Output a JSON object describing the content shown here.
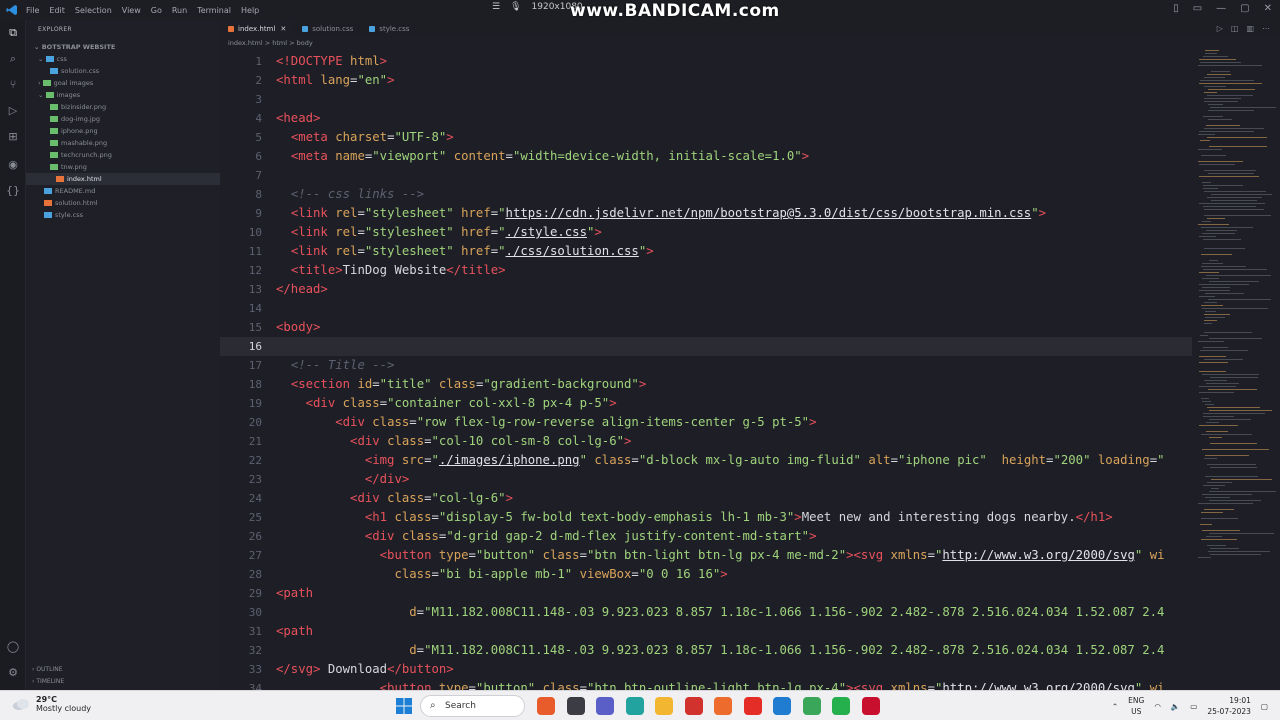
{
  "titlebar": {
    "menu": [
      "File",
      "Edit",
      "Selection",
      "View",
      "Go",
      "Run",
      "Terminal",
      "Help"
    ],
    "watermark": "www.BANDICAM.com",
    "resolution": "1920x1080"
  },
  "sidebar": {
    "header": "EXPLORER",
    "project": "BOTSTRAP WEBSITE",
    "items": [
      {
        "label": "css",
        "color": "#4aa3df"
      },
      {
        "label": "solution.css",
        "color": "#4aa3df"
      },
      {
        "label": "goal images",
        "color": "#6bbd6e"
      },
      {
        "label": "images",
        "color": "#6bbd6e"
      },
      {
        "label": "bizinsider.png",
        "color": "#6bbd6e"
      },
      {
        "label": "dog-img.jpg",
        "color": "#6bbd6e"
      },
      {
        "label": "iphone.png",
        "color": "#6bbd6e"
      },
      {
        "label": "mashable.png",
        "color": "#6bbd6e"
      },
      {
        "label": "techcrunch.png",
        "color": "#6bbd6e"
      },
      {
        "label": "tnw.png",
        "color": "#6bbd6e"
      },
      {
        "label": "index.html",
        "color": "#e8733a"
      },
      {
        "label": "README.md",
        "color": "#4aa3df"
      },
      {
        "label": "solution.html",
        "color": "#e8733a"
      },
      {
        "label": "style.css",
        "color": "#4aa3df"
      }
    ],
    "outline": "OUTLINE",
    "timeline": "TIMELINE"
  },
  "tabs": [
    {
      "label": "index.html",
      "active": true,
      "color": "#e8733a"
    },
    {
      "label": "solution.css",
      "active": false,
      "color": "#4aa3df"
    },
    {
      "label": "style.css",
      "active": false,
      "color": "#4aa3df"
    }
  ],
  "breadcrumb": "index.html > html > body",
  "code": {
    "current_line": 16,
    "lines": [
      {
        "n": "1",
        "html": "<span class='tg'>&lt;!DOCTYPE </span><span class='at'>html</span><span class='tg'>&gt;</span>"
      },
      {
        "n": "2",
        "html": "<span class='tg'>&lt;html </span><span class='at'>lang</span><span class='pl'>=</span><span class='st'>\"en\"</span><span class='tg'>&gt;</span>"
      },
      {
        "n": "3",
        "html": ""
      },
      {
        "n": "4",
        "html": "<span class='tg'>&lt;head&gt;</span>"
      },
      {
        "n": "5",
        "html": "  <span class='tg'>&lt;meta </span><span class='at'>charset</span><span class='pl'>=</span><span class='st'>\"UTF-8\"</span><span class='tg'>&gt;</span>"
      },
      {
        "n": "6",
        "html": "  <span class='tg'>&lt;meta </span><span class='at'>name</span><span class='pl'>=</span><span class='st'>\"viewport\"</span> <span class='at'>content</span><span class='pl'>=</span><span class='st'>\"width=device-width, initial-scale=1.0\"</span><span class='tg'>&gt;</span>"
      },
      {
        "n": "7",
        "html": ""
      },
      {
        "n": "8",
        "html": "  <span class='cm'>&lt;!-- css links --&gt;</span>"
      },
      {
        "n": "9",
        "html": "  <span class='tg'>&lt;link </span><span class='at'>rel</span><span class='pl'>=</span><span class='st'>\"stylesheet\"</span> <span class='at'>href</span><span class='pl'>=</span><span class='st'>\"<span class='ul'>https://cdn.jsdelivr.net/npm/bootstrap@5.3.0/dist/css/bootstrap.min.css</span>\"</span><span class='tg'>&gt;</span>"
      },
      {
        "n": "10",
        "html": "  <span class='tg'>&lt;link </span><span class='at'>rel</span><span class='pl'>=</span><span class='st'>\"stylesheet\"</span> <span class='at'>href</span><span class='pl'>=</span><span class='st'>\"<span class='ul'>./style.css</span>\"</span><span class='tg'>&gt;</span>"
      },
      {
        "n": "11",
        "html": "  <span class='tg'>&lt;link </span><span class='at'>rel</span><span class='pl'>=</span><span class='st'>\"stylesheet\"</span> <span class='at'>href</span><span class='pl'>=</span><span class='st'>\"<span class='ul'>./css/solution.css</span>\"</span><span class='tg'>&gt;</span>"
      },
      {
        "n": "12",
        "html": "  <span class='tg'>&lt;title&gt;</span><span class='pl'>TinDog Website</span><span class='tg'>&lt;/title&gt;</span>"
      },
      {
        "n": "13",
        "html": "<span class='tg'>&lt;/head&gt;</span>"
      },
      {
        "n": "14",
        "html": ""
      },
      {
        "n": "15",
        "html": "<span class='tg'>&lt;body&gt;</span>"
      },
      {
        "n": "16",
        "html": ""
      },
      {
        "n": "17",
        "html": "  <span class='cm'>&lt;!-- Title --&gt;</span>"
      },
      {
        "n": "18",
        "html": "  <span class='tg'>&lt;section </span><span class='at'>id</span><span class='pl'>=</span><span class='st'>\"title\"</span> <span class='at'>class</span><span class='pl'>=</span><span class='st'>\"gradient-background\"</span><span class='tg'>&gt;</span>"
      },
      {
        "n": "19",
        "html": "    <span class='tg'>&lt;div </span><span class='at'>class</span><span class='pl'>=</span><span class='st'>\"container col-xxl-8 px-4 p-5\"</span><span class='tg'>&gt;</span>"
      },
      {
        "n": "20",
        "html": "        <span class='tg'>&lt;div </span><span class='at'>class</span><span class='pl'>=</span><span class='st'>\"row flex-lg-row-reverse align-items-center g-5 pt-5\"</span><span class='tg'>&gt;</span>"
      },
      {
        "n": "21",
        "html": "          <span class='tg'>&lt;div </span><span class='at'>class</span><span class='pl'>=</span><span class='st'>\"col-10 col-sm-8 col-lg-6\"</span><span class='tg'>&gt;</span>"
      },
      {
        "n": "22",
        "html": "            <span class='tg'>&lt;img </span><span class='at'>src</span><span class='pl'>=</span><span class='st'>\"<span class='ul'>./images/iphone.png</span>\"</span> <span class='at'>class</span><span class='pl'>=</span><span class='st'>\"d-block mx-lg-auto img-fluid\"</span> <span class='at'>alt</span><span class='pl'>=</span><span class='st'>\"iphone pic\"</span>  <span class='at'>height</span><span class='pl'>=</span><span class='st'>\"200\"</span> <span class='at'>loading</span><span class='pl'>=</span><span class='st'>\"</span>"
      },
      {
        "n": "23",
        "html": "            <span class='tg'>&lt;/div&gt;</span>"
      },
      {
        "n": "24",
        "html": "          <span class='tg'>&lt;div </span><span class='at'>class</span><span class='pl'>=</span><span class='st'>\"col-lg-6\"</span><span class='tg'>&gt;</span>"
      },
      {
        "n": "25",
        "html": "            <span class='tg'>&lt;h1 </span><span class='at'>class</span><span class='pl'>=</span><span class='st'>\"display-5 fw-bold text-body-emphasis lh-1 mb-3\"</span><span class='tg'>&gt;</span><span class='pl'>Meet new and interesting dogs nearby.</span><span class='tg'>&lt;/h1&gt;</span>"
      },
      {
        "n": "26",
        "html": "            <span class='tg'>&lt;div </span><span class='at'>class</span><span class='pl'>=</span><span class='st'>\"d-grid gap-2 d-md-flex justify-content-md-start\"</span><span class='tg'>&gt;</span>"
      },
      {
        "n": "27",
        "html": "              <span class='tg'>&lt;button </span><span class='at'>type</span><span class='pl'>=</span><span class='st'>\"button\"</span> <span class='at'>class</span><span class='pl'>=</span><span class='st'>\"btn btn-light btn-lg px-4 me-md-2\"</span><span class='tg'>&gt;&lt;svg </span><span class='at'>xmlns</span><span class='pl'>=</span><span class='st'>\"<span class='ul'>http://www.w3.org/2000/svg</span>\"</span> <span class='at'>wi</span>"
      },
      {
        "n": "28",
        "html": "                <span class='at'>class</span><span class='pl'>=</span><span class='st'>\"bi bi-apple mb-1\"</span> <span class='at'>viewBox</span><span class='pl'>=</span><span class='st'>\"0 0 16 16\"</span><span class='tg'>&gt;</span>"
      },
      {
        "n": "29",
        "html": "<span class='tg'>&lt;path</span>"
      },
      {
        "n": "30",
        "html": "                  <span class='at'>d</span><span class='pl'>=</span><span class='st'>\"M11.182.008C11.148-.03 9.923.023 8.857 1.18c-1.066 1.156-.902 2.482-.878 2.516.024.034 1.52.087 2.4</span>"
      },
      {
        "n": "31",
        "html": "<span class='tg'>&lt;path</span>"
      },
      {
        "n": "32",
        "html": "                  <span class='at'>d</span><span class='pl'>=</span><span class='st'>\"M11.182.008C11.148-.03 9.923.023 8.857 1.18c-1.066 1.156-.902 2.482-.878 2.516.024.034 1.52.087 2.4</span>"
      },
      {
        "n": "33",
        "html": "<span class='tg'>&lt;/svg&gt;</span> <span class='pl'>Download</span><span class='tg'>&lt;/button&gt;</span>"
      },
      {
        "n": "34",
        "html": "              <span class='tg'>&lt;button </span><span class='at'>type</span><span class='pl'>=</span><span class='st'>\"button\"</span> <span class='at'>class</span><span class='pl'>=</span><span class='st'>\"btn btn-outline-light btn-lg px-4\"</span><span class='tg'>&gt;&lt;svg </span><span class='at'>xmlns</span><span class='pl'>=</span><span class='st'>\"<span class='ul'>http://www.w3.org/2000/svg</span>\"</span> <span class='at'>wi</span>"
      }
    ]
  },
  "taskbar": {
    "temperature": "29°C",
    "weather": "Mostly cloudy",
    "search_label": "Search",
    "lang_top": "ENG",
    "lang_bottom": "US",
    "time": "19:01",
    "date": "25-07-2023",
    "icons": [
      {
        "name": "app-icon-1",
        "color": "#e85c2b"
      },
      {
        "name": "app-icon-2",
        "color": "#3c3c44"
      },
      {
        "name": "app-icon-3",
        "color": "#5a5fc7"
      },
      {
        "name": "app-icon-4",
        "color": "#22a39f"
      },
      {
        "name": "app-icon-5",
        "color": "#f2b630"
      },
      {
        "name": "app-icon-6",
        "color": "#d2322d"
      },
      {
        "name": "app-icon-7",
        "color": "#ec6b2d"
      },
      {
        "name": "app-icon-8",
        "color": "#e52d27"
      },
      {
        "name": "app-icon-9",
        "color": "#1f7cd1"
      },
      {
        "name": "app-icon-10",
        "color": "#3aa65a"
      },
      {
        "name": "app-icon-11",
        "color": "#25b04d"
      },
      {
        "name": "app-icon-12",
        "color": "#c8102e"
      }
    ]
  }
}
